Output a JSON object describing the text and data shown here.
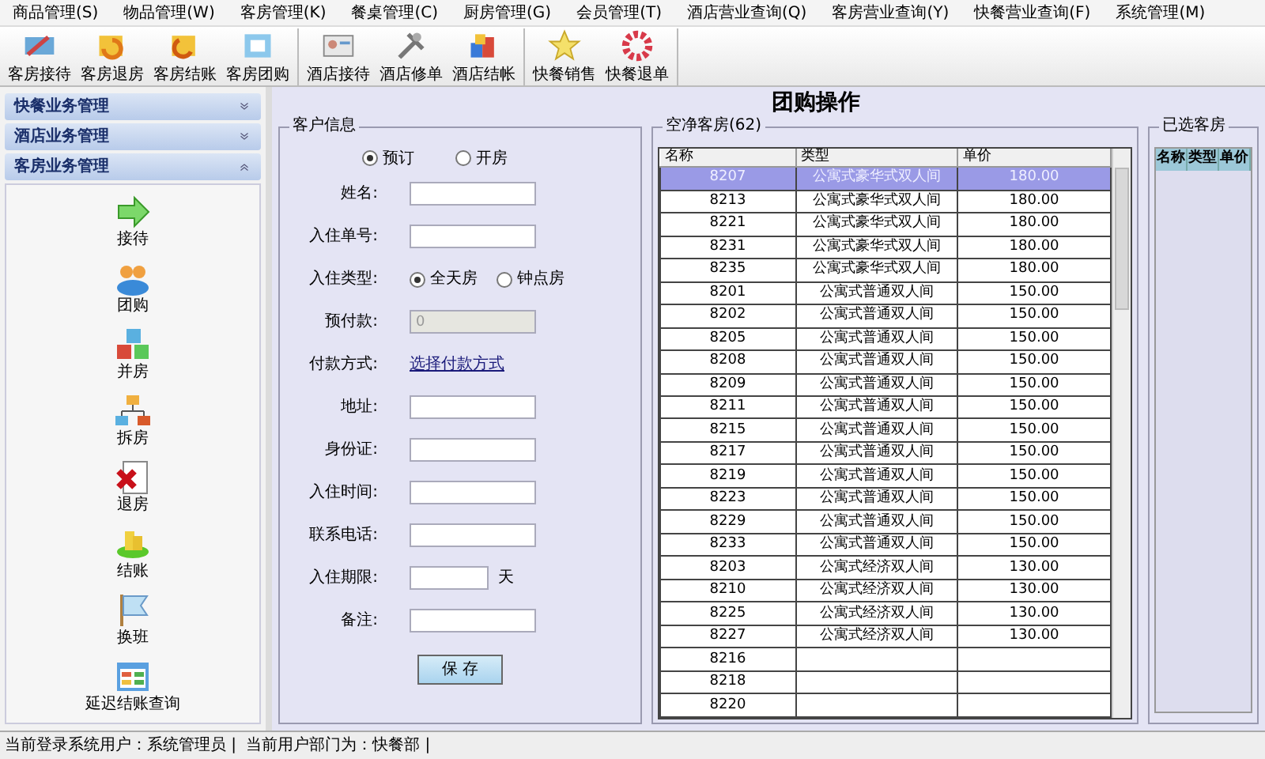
{
  "menu": [
    "商品管理(S)",
    "物品管理(W)",
    "客房管理(K)",
    "餐桌管理(C)",
    "厨房管理(G)",
    "会员管理(T)",
    "酒店营业查询(Q)",
    "客房营业查询(Y)",
    "快餐营业查询(F)",
    "系统管理(M)"
  ],
  "toolbar": [
    [
      {
        "label": "客房接待"
      },
      {
        "label": "客房退房"
      },
      {
        "label": "客房结账"
      },
      {
        "label": "客房团购"
      }
    ],
    [
      {
        "label": "酒店接待"
      },
      {
        "label": "酒店修单"
      },
      {
        "label": "酒店结帐"
      }
    ],
    [
      {
        "label": "快餐销售"
      },
      {
        "label": "快餐退单"
      }
    ]
  ],
  "sidebar": [
    {
      "title": "快餐业务管理",
      "expanded": false
    },
    {
      "title": "酒店业务管理",
      "expanded": false
    },
    {
      "title": "客房业务管理",
      "expanded": true,
      "items": [
        {
          "label": "接待"
        },
        {
          "label": "团购"
        },
        {
          "label": "并房"
        },
        {
          "label": "拆房"
        },
        {
          "label": "退房"
        },
        {
          "label": "结账"
        },
        {
          "label": "换班"
        },
        {
          "label": "延迟结账查询"
        }
      ]
    }
  ],
  "title": "团购操作",
  "customer": {
    "legend": "客户信息",
    "mode": [
      {
        "label": "预订",
        "selected": true
      },
      {
        "label": "开房",
        "selected": false
      }
    ],
    "fields": [
      {
        "kind": "text",
        "label": "姓名:"
      },
      {
        "kind": "text",
        "label": "入住单号:"
      },
      {
        "kind": "radio",
        "label": "入住类型:",
        "options": [
          {
            "label": "全天房",
            "selected": true
          },
          {
            "label": "钟点房",
            "selected": false
          }
        ]
      },
      {
        "kind": "text",
        "label": "预付款:",
        "value": "0",
        "disabled": true
      },
      {
        "kind": "link",
        "label": "付款方式:",
        "link": "选择付款方式"
      },
      {
        "kind": "text",
        "label": "地址:"
      },
      {
        "kind": "text",
        "label": "身份证:"
      },
      {
        "kind": "text",
        "label": "入住时间:"
      },
      {
        "kind": "text",
        "label": "联系电话:"
      },
      {
        "kind": "text",
        "label": "入住期限:",
        "suffix": "天"
      },
      {
        "kind": "text",
        "label": "备注:"
      }
    ],
    "save": "保 存"
  },
  "rooms": {
    "legend": "空净客房(62)",
    "columns": [
      "名称",
      "类型",
      "单价"
    ],
    "rows": [
      {
        "cells": [
          "8207",
          "公寓式豪华式双人间",
          "180.00"
        ],
        "selected": true
      },
      {
        "cells": [
          "8213",
          "公寓式豪华式双人间",
          "180.00"
        ],
        "selected": false
      },
      {
        "cells": [
          "8221",
          "公寓式豪华式双人间",
          "180.00"
        ],
        "selected": false
      },
      {
        "cells": [
          "8231",
          "公寓式豪华式双人间",
          "180.00"
        ],
        "selected": false
      },
      {
        "cells": [
          "8235",
          "公寓式豪华式双人间",
          "180.00"
        ],
        "selected": false
      },
      {
        "cells": [
          "8201",
          "公寓式普通双人间",
          "150.00"
        ],
        "selected": false
      },
      {
        "cells": [
          "8202",
          "公寓式普通双人间",
          "150.00"
        ],
        "selected": false
      },
      {
        "cells": [
          "8205",
          "公寓式普通双人间",
          "150.00"
        ],
        "selected": false
      },
      {
        "cells": [
          "8208",
          "公寓式普通双人间",
          "150.00"
        ],
        "selected": false
      },
      {
        "cells": [
          "8209",
          "公寓式普通双人间",
          "150.00"
        ],
        "selected": false
      },
      {
        "cells": [
          "8211",
          "公寓式普通双人间",
          "150.00"
        ],
        "selected": false
      },
      {
        "cells": [
          "8215",
          "公寓式普通双人间",
          "150.00"
        ],
        "selected": false
      },
      {
        "cells": [
          "8217",
          "公寓式普通双人间",
          "150.00"
        ],
        "selected": false
      },
      {
        "cells": [
          "8219",
          "公寓式普通双人间",
          "150.00"
        ],
        "selected": false
      },
      {
        "cells": [
          "8223",
          "公寓式普通双人间",
          "150.00"
        ],
        "selected": false
      },
      {
        "cells": [
          "8229",
          "公寓式普通双人间",
          "150.00"
        ],
        "selected": false
      },
      {
        "cells": [
          "8233",
          "公寓式普通双人间",
          "150.00"
        ],
        "selected": false
      },
      {
        "cells": [
          "8203",
          "公寓式经济双人间",
          "130.00"
        ],
        "selected": false
      },
      {
        "cells": [
          "8210",
          "公寓式经济双人间",
          "130.00"
        ],
        "selected": false
      },
      {
        "cells": [
          "8225",
          "公寓式经济双人间",
          "130.00"
        ],
        "selected": false
      },
      {
        "cells": [
          "8227",
          "公寓式经济双人间",
          "130.00"
        ],
        "selected": false
      },
      {
        "cells": [
          "8216"
        ],
        "selected": false
      },
      {
        "cells": [
          "8218"
        ],
        "selected": false
      },
      {
        "cells": [
          "8220"
        ],
        "selected": false
      }
    ]
  },
  "chosen": {
    "legend": "已选客房",
    "columns": [
      "名称",
      "类型",
      "单价"
    ]
  },
  "status_bar": [
    "当前登录系统用户：系统管理员 |",
    "当前用户部门为：快餐部 |"
  ]
}
